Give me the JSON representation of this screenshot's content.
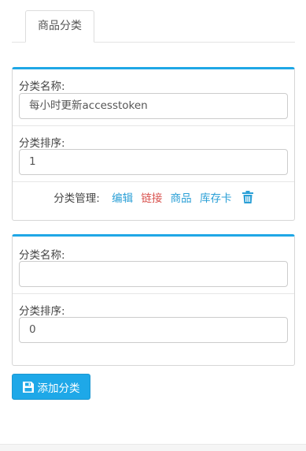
{
  "tabs": [
    {
      "label": "商品分类"
    }
  ],
  "categories": [
    {
      "name_label": "分类名称:",
      "name_value": "每小时更新accesstoken",
      "sort_label": "分类排序:",
      "sort_value": "1",
      "manage_label": "分类管理:",
      "actions": {
        "edit": "编辑",
        "link": "链接",
        "goods": "商品",
        "stock_card": "库存卡"
      },
      "delete_icon": "trash-icon"
    },
    {
      "name_label": "分类名称:",
      "name_value": "",
      "sort_label": "分类排序:",
      "sort_value": "0"
    }
  ],
  "add_button": {
    "label": "添加分类",
    "icon": "save-icon"
  },
  "colors": {
    "accent": "#1fa7e6",
    "link_blue": "#2a9fd6",
    "link_red": "#d9534f",
    "button_bg": "#1ea8e8"
  }
}
